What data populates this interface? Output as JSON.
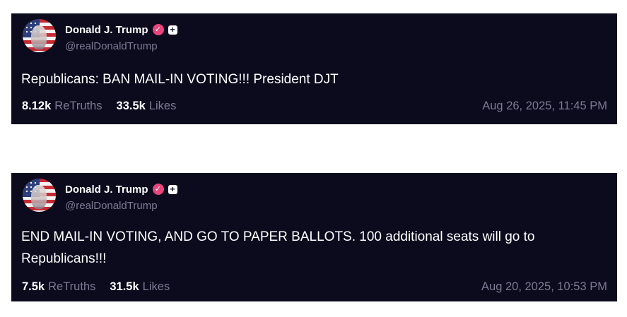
{
  "posts": [
    {
      "author": {
        "name": "Donald J. Trump",
        "handle": "@realDonaldTrump",
        "verified_icon": "verified-badge-icon",
        "plus_icon": "plus-icon"
      },
      "text": "Republicans: BAN MAIL-IN VOTING!!! President DJT",
      "retruths_count": "8.12k",
      "retruths_label": "ReTruths",
      "likes_count": "33.5k",
      "likes_label": "Likes",
      "timestamp": "Aug 26, 2025, 11:45 PM"
    },
    {
      "author": {
        "name": "Donald J. Trump",
        "handle": "@realDonaldTrump",
        "verified_icon": "verified-badge-icon",
        "plus_icon": "plus-icon"
      },
      "text": "END MAIL-IN VOTING, AND GO TO PAPER BALLOTS. 100 additional seats will go to Republicans!!!",
      "retruths_count": "7.5k",
      "retruths_label": "ReTruths",
      "likes_count": "31.5k",
      "likes_label": "Likes",
      "timestamp": "Aug 20, 2025, 10:53 PM"
    }
  ],
  "colors": {
    "card_background": "#0c0b1e",
    "muted_text": "#7d7a92",
    "verified_badge": "#e8457a",
    "page_background": "#ffffff"
  }
}
